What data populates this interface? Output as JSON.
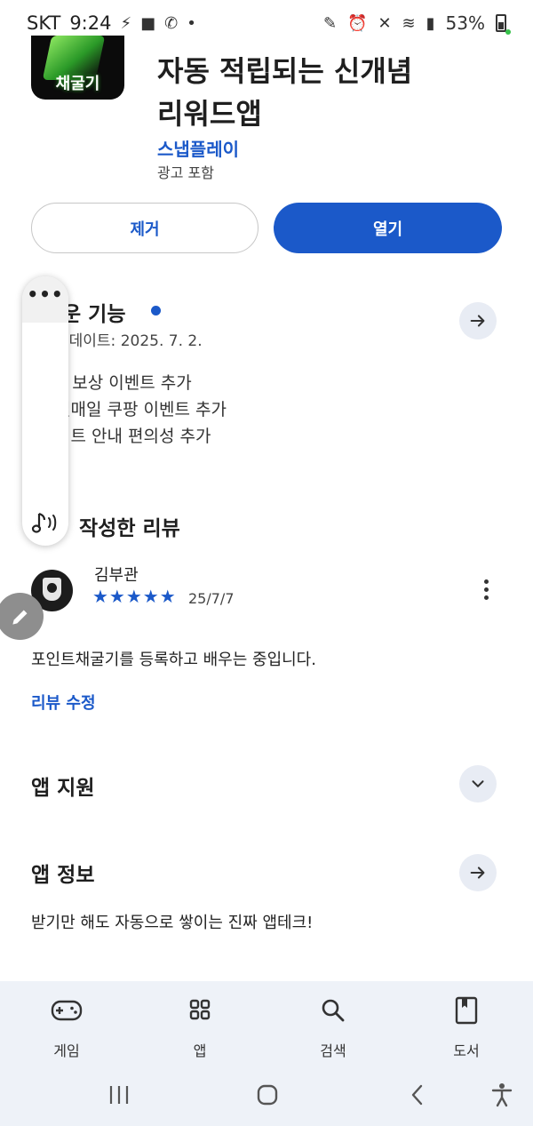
{
  "status_bar": {
    "carrier": "SKT",
    "time": "9:24",
    "battery": "53%"
  },
  "app": {
    "icon_label": "채굴기",
    "title_line1": "자동 적립되는 신개념",
    "title_line2": "리워드앱",
    "developer": "스냅플레이",
    "ad_notice": "광고 포함"
  },
  "buttons": {
    "remove": "제거",
    "open": "열기"
  },
  "whats_new": {
    "title": "운 기능",
    "updated": "업데이트: 2025. 7. 2.",
    "notes": [
      "C 보상 이벤트 추가",
      "일매일 쿠팡 이벤트 추가",
      "이트 안내 편의성 추가"
    ]
  },
  "floating_panel": {
    "more": "•••"
  },
  "review_section": {
    "title": "작성한 리뷰",
    "reviewer": "김부관",
    "rating": 5,
    "stars": "★★★★★",
    "date": "25/7/7",
    "text": "포인트채굴기를 등록하고 배우는 중입니다.",
    "edit_link": "리뷰 수정"
  },
  "app_support": {
    "title": "앱 지원"
  },
  "app_info": {
    "title": "앱 정보",
    "description": "받기만 해도 자동으로 쌓이는 진짜 앱테크!"
  },
  "bottom_nav": [
    {
      "label": "게임",
      "icon": "gamepad-icon"
    },
    {
      "label": "앱",
      "icon": "apps-grid-icon"
    },
    {
      "label": "검색",
      "icon": "search-icon"
    },
    {
      "label": "도서",
      "icon": "book-icon"
    }
  ],
  "colors": {
    "accent": "#1b59c9",
    "nav_background": "#eef2f8",
    "round_button": "#e8ecf4"
  }
}
